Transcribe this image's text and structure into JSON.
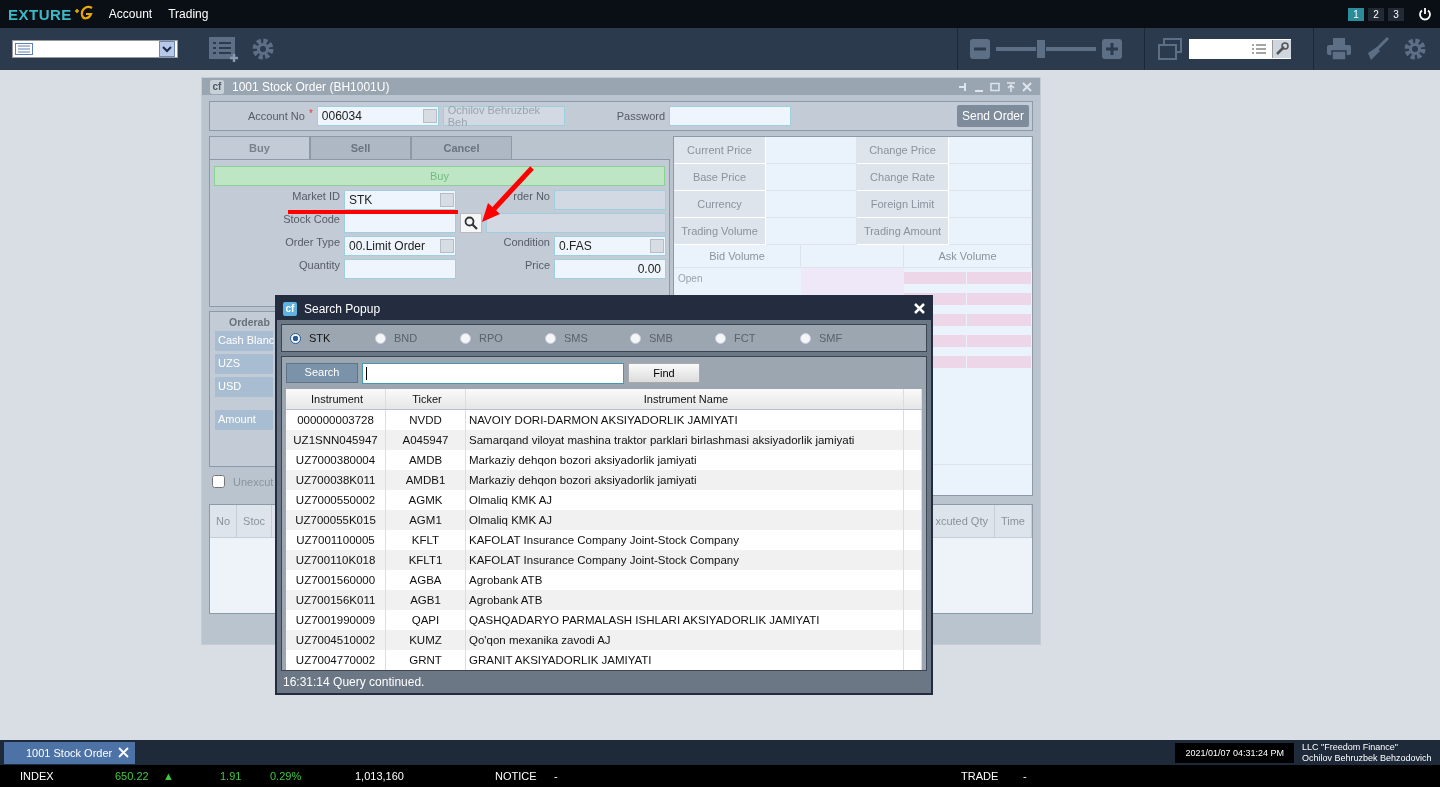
{
  "app": {
    "logo": "EXTURE",
    "menu": [
      {
        "label": "Account"
      },
      {
        "label": "Trading"
      }
    ],
    "workspaces": [
      {
        "label": "1",
        "selected": true
      },
      {
        "label": "2",
        "selected": false
      },
      {
        "label": "3",
        "selected": false
      }
    ]
  },
  "toolbar": {
    "zoom": {
      "level": 0.45
    }
  },
  "order_window": {
    "app_icon": "cf",
    "title": "1001 Stock Order (BH1001U)",
    "account": {
      "label": "Account No",
      "required_mark": "*",
      "value": "006034",
      "name": "Ochilov Behruzbek Beh"
    },
    "password": {
      "label": "Password"
    },
    "send_button": "Send Order",
    "tabs": [
      {
        "label": "Buy",
        "selected": true
      },
      {
        "label": "Sell",
        "selected": false
      },
      {
        "label": "Cancel",
        "selected": false
      }
    ],
    "banner": "Buy",
    "form": {
      "market_id": {
        "label": "Market ID",
        "value": "STK"
      },
      "order_no": {
        "label": "rder No"
      },
      "stock_code": {
        "label": "Stock Code"
      },
      "order_type": {
        "label": "Order Type",
        "value": "00.Limit Order"
      },
      "condition": {
        "label": "Condition",
        "value": "0.FAS"
      },
      "quantity": {
        "label": "Quantity"
      },
      "price": {
        "label": "Price",
        "value": "0.00"
      }
    },
    "orderable": {
      "title": "Orderab",
      "rows": [
        "Cash Blanc",
        "UZS",
        "USD",
        "Amount"
      ]
    },
    "unexecuted": {
      "label": "Unexcut",
      "checked": false
    },
    "orders_table": {
      "columns_left": [
        "No",
        "Stoc"
      ],
      "columns_right": [
        "xcuted Qty",
        "Time"
      ]
    },
    "quote": {
      "fields": [
        "Current Price",
        "Change Price",
        "Base Price",
        "Change Rate",
        "Currency",
        "Foreign Limit",
        "Trading Volume",
        "Trading Amount"
      ],
      "bid_header": "Bid Volume",
      "ask_header": "Ask Volume",
      "open_label": "Open"
    }
  },
  "popup": {
    "app_icon": "cf",
    "title": "Search Popup",
    "markets": [
      {
        "label": "STK",
        "selected": true
      },
      {
        "label": "BND",
        "selected": false
      },
      {
        "label": "RPO",
        "selected": false
      },
      {
        "label": "SMS",
        "selected": false
      },
      {
        "label": "SMB",
        "selected": false
      },
      {
        "label": "FCT",
        "selected": false
      },
      {
        "label": "SMF",
        "selected": false
      }
    ],
    "search_label": "Search",
    "find_button": "Find",
    "columns": [
      "Instrument",
      "Ticker",
      "Instrument Name"
    ],
    "rows": [
      {
        "instrument": "000000003728",
        "ticker": "NVDD",
        "name": "NAVOIY DORI-DARMON AKSIYADORLIK JAMIYATI"
      },
      {
        "instrument": "UZ1SNN045947",
        "ticker": "A045947",
        "name": "Samarqand viloyat mashina traktor parklari birlashmasi aksiyadorlik jamiyati"
      },
      {
        "instrument": "UZ7000380004",
        "ticker": "AMDB",
        "name": "Markaziy dehqon bozori aksiyadorlik jamiyati"
      },
      {
        "instrument": "UZ700038K011",
        "ticker": "AMDB1",
        "name": "Markaziy dehqon bozori aksiyadorlik jamiyati"
      },
      {
        "instrument": "UZ7000550002",
        "ticker": "AGMK",
        "name": "Olmaliq KMK AJ"
      },
      {
        "instrument": "UZ700055K015",
        "ticker": "AGM1",
        "name": "Olmaliq KMK AJ"
      },
      {
        "instrument": "UZ7001100005",
        "ticker": "KFLT",
        "name": "KAFOLAT Insurance Company Joint-Stock Company"
      },
      {
        "instrument": "UZ700110K018",
        "ticker": "KFLT1",
        "name": "KAFOLAT Insurance Company Joint-Stock Company"
      },
      {
        "instrument": "UZ7001560000",
        "ticker": "AGBA",
        "name": "Agrobank ATB"
      },
      {
        "instrument": "UZ700156K011",
        "ticker": "AGB1",
        "name": "Agrobank ATB"
      },
      {
        "instrument": "UZ7001990009",
        "ticker": "QAPI",
        "name": "QASHQADARYO PARMALASH ISHLARI AKSIYADORLIK JAMIYATI"
      },
      {
        "instrument": "UZ7004510002",
        "ticker": "KUMZ",
        "name": "Qo'qon mexanika zavodi AJ"
      },
      {
        "instrument": "UZ7004770002",
        "ticker": "GRNT",
        "name": "GRANIT AKSIYADORLIK JAMIYATI"
      }
    ],
    "status": "16:31:14 Query continued."
  },
  "taskbar": {
    "tabs": [
      {
        "label": "1001 Stock Order",
        "selected": true
      }
    ],
    "datetime": "2021/01/07 04:31:24 PM",
    "company": "LLC \"Freedom Finance\"",
    "user": "Ochilov Behruzbek Behzodovich"
  },
  "ticker": {
    "index_label": "INDEX",
    "index_value": "650.22",
    "arrow": "▲",
    "change": "1.91",
    "change_pct": "0.29%",
    "volume": "1,013,160",
    "notice_label": "NOTICE",
    "notice": "-",
    "trade_label": "TRADE",
    "trade": "-"
  }
}
